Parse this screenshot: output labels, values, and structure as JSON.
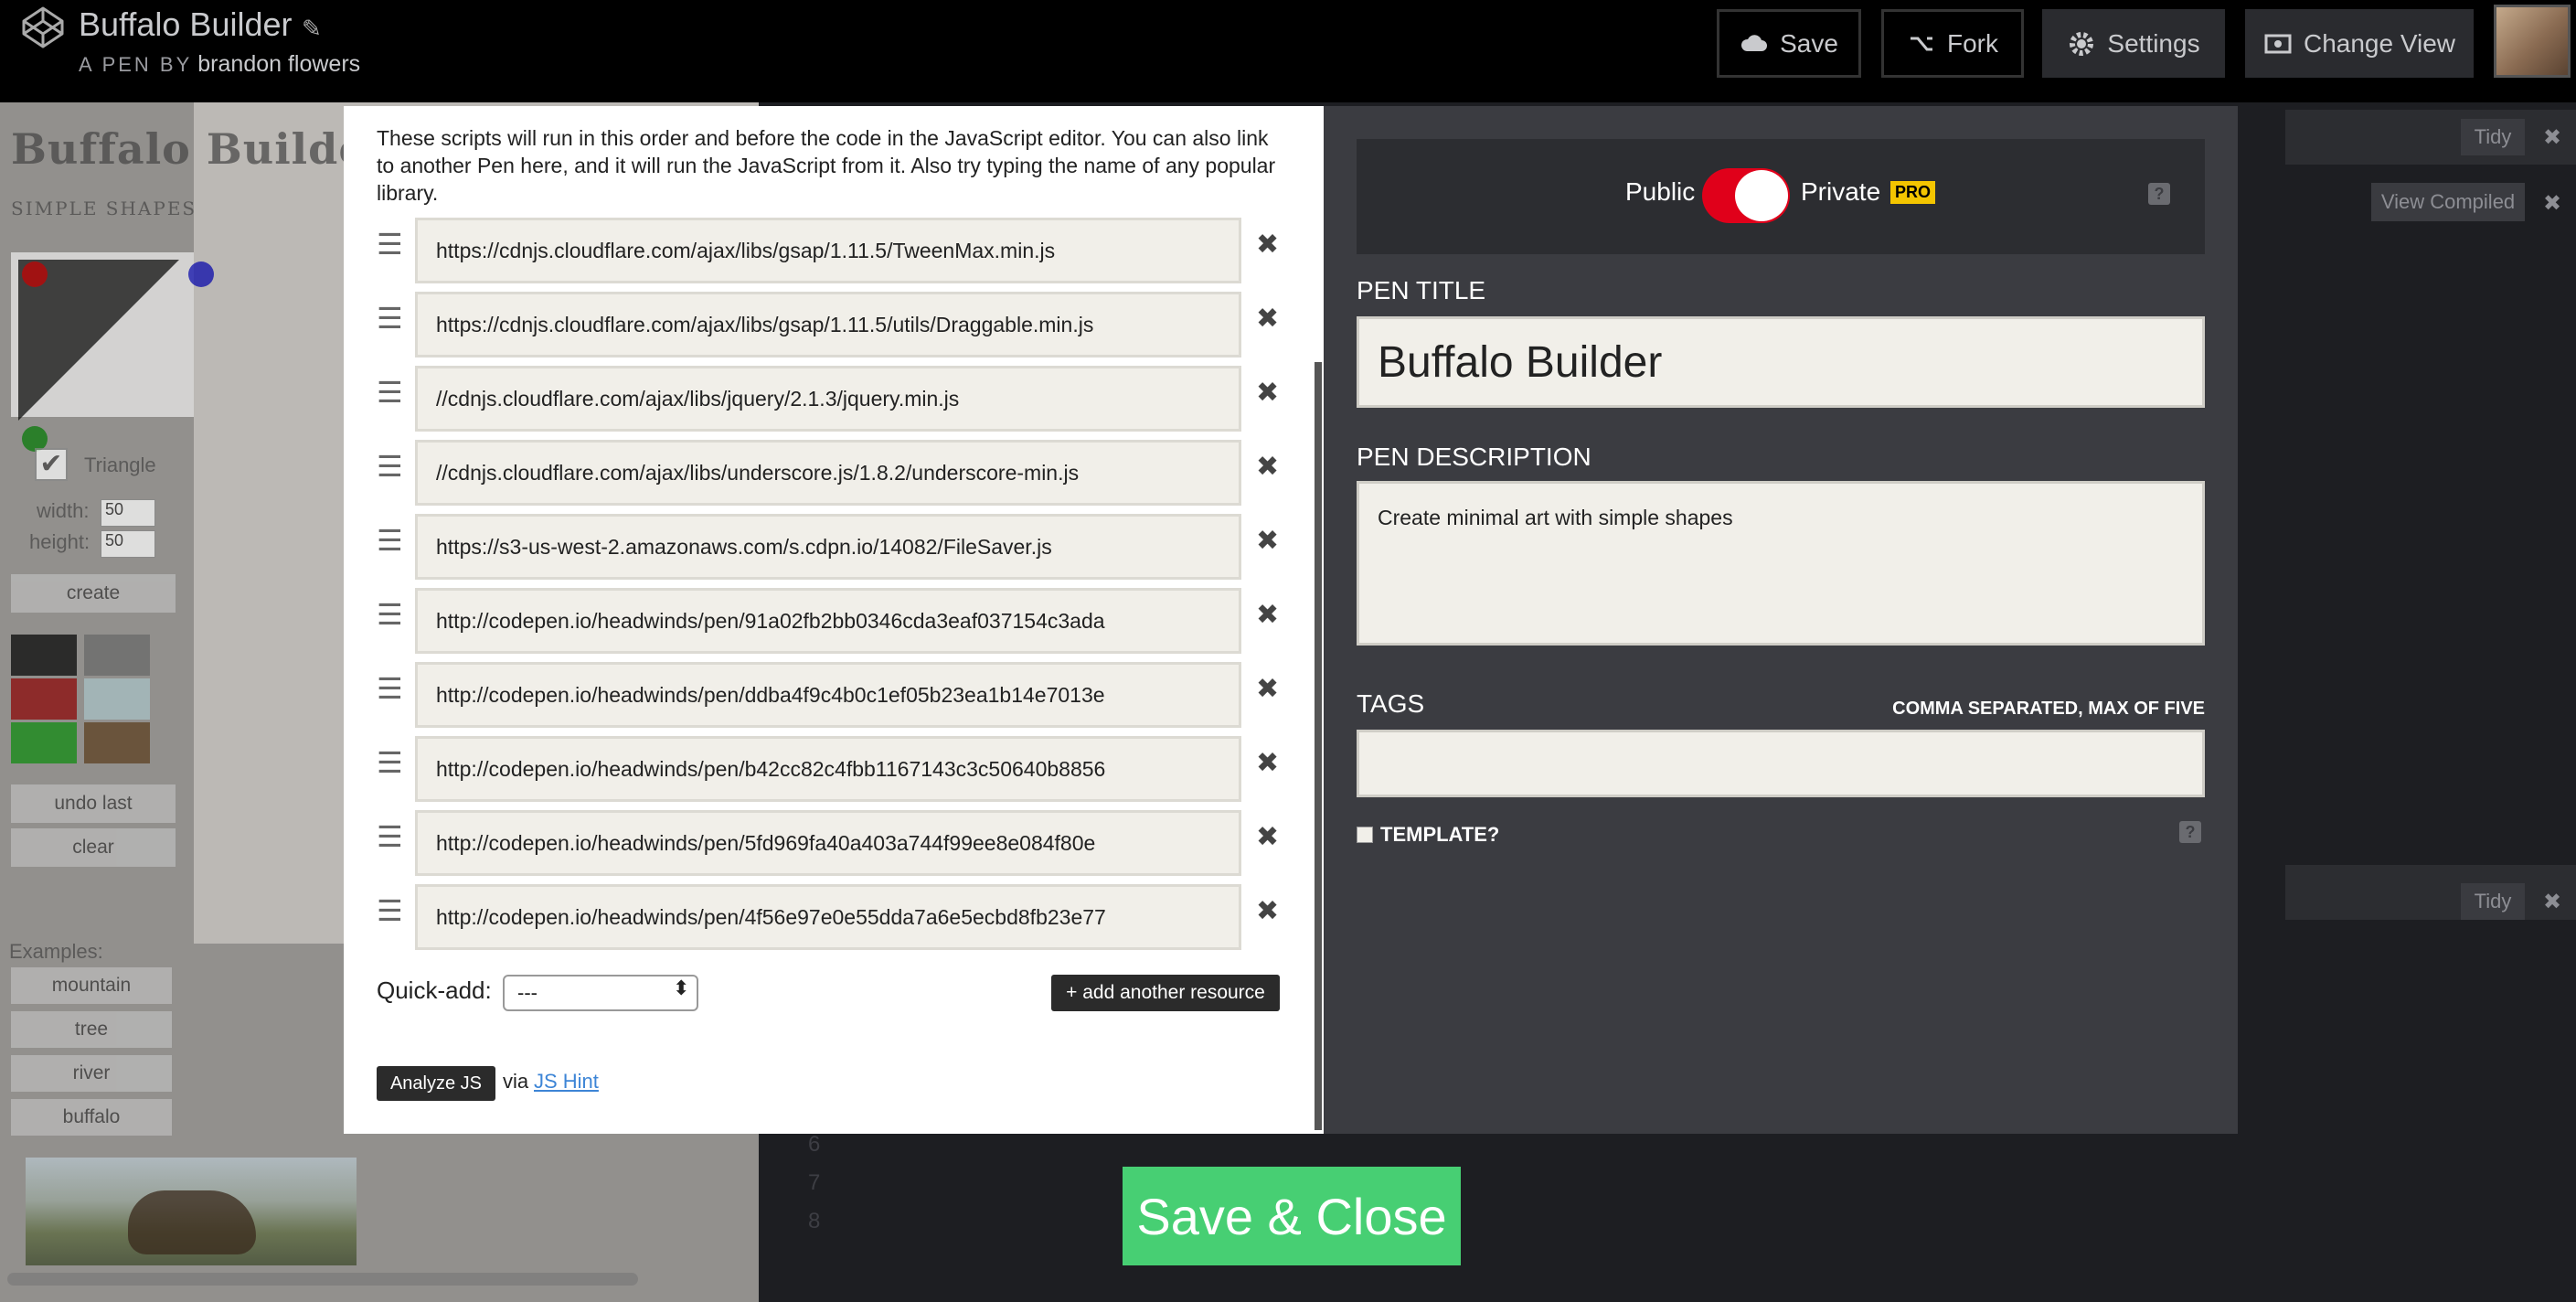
{
  "header": {
    "title": "Buffalo Builder",
    "by_label": "A PEN BY",
    "author": "brandon flowers",
    "buttons": {
      "save": "Save",
      "fork": "Fork",
      "settings": "Settings",
      "change_view": "Change View"
    }
  },
  "preview": {
    "title": "Buffalo Builde",
    "subtitle": "SIMPLE SHAPES",
    "shape_label": "Triangle",
    "width_label": "width:",
    "width_value": "50",
    "height_label": "height:",
    "height_value": "50",
    "create": "create",
    "undo": "undo last",
    "clear": "clear",
    "examples_label": "Examples:",
    "examples": [
      "mountain",
      "tree",
      "river",
      "buffalo"
    ],
    "swatch_colors": [
      "#000000",
      "#666666",
      "#8b0000",
      "#a9c3c8",
      "#0a8a0a",
      "#5a3a1a"
    ]
  },
  "editor": {
    "tidy": "Tidy",
    "view_compiled": "View Compiled",
    "tidy2": "Tidy",
    "line_numbers": [
      "6",
      "7",
      "8"
    ]
  },
  "modal": {
    "intro": "These scripts will run in this order and before the code in the JavaScript editor. You can also link to another Pen here, and it will run the JavaScript from it. Also try typing the name of any popular library.",
    "resources": [
      "https://cdnjs.cloudflare.com/ajax/libs/gsap/1.11.5/TweenMax.min.js",
      "https://cdnjs.cloudflare.com/ajax/libs/gsap/1.11.5/utils/Draggable.min.js",
      "//cdnjs.cloudflare.com/ajax/libs/jquery/2.1.3/jquery.min.js",
      "//cdnjs.cloudflare.com/ajax/libs/underscore.js/1.8.2/underscore-min.js",
      "https://s3-us-west-2.amazonaws.com/s.cdpn.io/14082/FileSaver.js",
      "http://codepen.io/headwinds/pen/91a02fb2bb0346cda3eaf037154c3ada",
      "http://codepen.io/headwinds/pen/ddba4f9c4b0c1ef05b23ea1b14e7013e",
      "http://codepen.io/headwinds/pen/b42cc82c4fbb1167143c3c50640b8856",
      "http://codepen.io/headwinds/pen/5fd969fa40a403a744f99ee8e084f80e",
      "http://codepen.io/headwinds/pen/4f56e97e0e55dda7a6e5ecbd8fb23e77"
    ],
    "quick_add_label": "Quick-add:",
    "quick_add_value": "---",
    "add_resource": "+ add another resource",
    "analyze": "Analyze JS",
    "via": "via",
    "jshint": "JS Hint",
    "visibility": {
      "public": "Public",
      "private": "Private",
      "pro": "PRO"
    },
    "pen_title_label": "PEN TITLE",
    "pen_title_value": "Buffalo Builder",
    "pen_desc_label": "PEN DESCRIPTION",
    "pen_desc_value": "Create minimal  art with simple shapes",
    "tags_label": "TAGS",
    "tags_hint": "COMMA SEPARATED, MAX OF FIVE",
    "template_label": "TEMPLATE?",
    "help": "?"
  },
  "save_close": "Save & Close",
  "colors": {
    "accent_green": "#47cf73",
    "toggle_red": "#e0001a",
    "pro_yellow": "#f4c500"
  }
}
